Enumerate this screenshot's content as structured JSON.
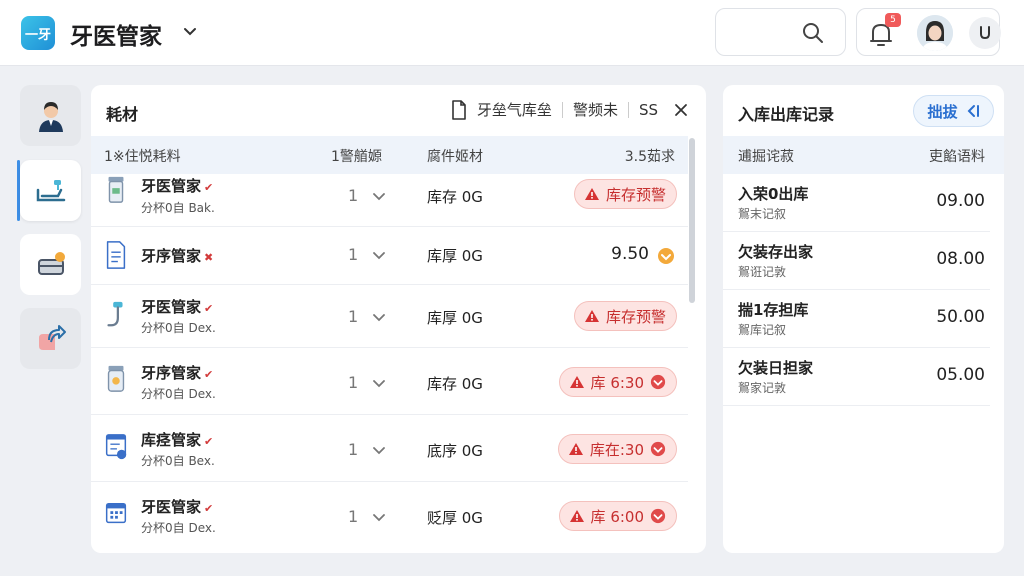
{
  "app": {
    "logo_text": "一牙",
    "title": "牙医管家"
  },
  "header": {
    "notification_badge": "5"
  },
  "main": {
    "title": "耗材",
    "toolbar": {
      "item1": "牙垒气库垒",
      "item2": "警频未",
      "item3": "SS"
    },
    "columns": {
      "col1": "1※住悦耗料",
      "col2": "1警艏嫄",
      "col3": "腐件姬材",
      "col4": "3.5茹求"
    },
    "rows": [
      {
        "name": "牙医管家",
        "sub": "分杯0自 Bak.",
        "qty": "1",
        "stock": "库存 0G",
        "status_type": "badge",
        "status": "库存预警",
        "icon": "toothpaste-icon"
      },
      {
        "name": "牙序管家",
        "sub": "",
        "qty": "1",
        "stock": "库厚 0G",
        "status_type": "value",
        "status": "9.50",
        "icon": "document-icon"
      },
      {
        "name": "牙医管家",
        "sub": "分杯0自 Dex.",
        "qty": "1",
        "stock": "库厚 0G",
        "status_type": "badge",
        "status": "库存预警",
        "icon": "dental-tool-icon"
      },
      {
        "name": "牙序管家",
        "sub": "分杯0自 Dex.",
        "qty": "1",
        "stock": "库存 0G",
        "status_type": "badge",
        "status": "库 6:30",
        "icon": "jar-icon"
      },
      {
        "name": "库痉管家",
        "sub": "分杯0自 Bex.",
        "qty": "1",
        "stock": "底序 0G",
        "status_type": "badge",
        "status": "库在:30",
        "icon": "form-icon"
      },
      {
        "name": "牙医管家",
        "sub": "分杯0自 Dex.",
        "qty": "1",
        "stock": "贬厚 0G",
        "status_type": "badge",
        "status": "库 6:00",
        "icon": "calendar-icon"
      }
    ]
  },
  "records": {
    "title": "入库出库记录",
    "button": "拙拔",
    "columns": {
      "col1": "逋掘诧菽",
      "col2": "吏餡语料"
    },
    "rows": [
      {
        "title": "入荣0出库",
        "sub": "鴽末记叙",
        "value": "09.00"
      },
      {
        "title": "欠装存出家",
        "sub": "鴽诳记敦",
        "value": "08.00"
      },
      {
        "title": "揣1存担库",
        "sub": "鴽库记叙",
        "value": "50.00"
      },
      {
        "title": "欠装日担家",
        "sub": "鴽家记敦",
        "value": "05.00"
      }
    ]
  }
}
